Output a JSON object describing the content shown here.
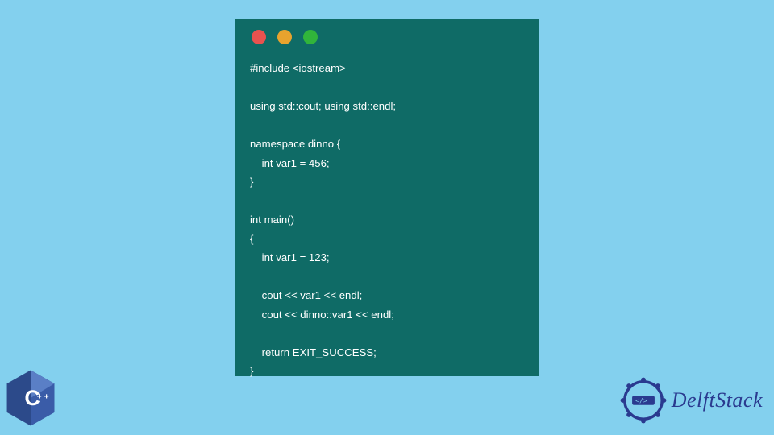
{
  "code_window": {
    "traffic_lights": [
      "red",
      "yellow",
      "green"
    ],
    "code": "#include <iostream>\n\nusing std::cout; using std::endl;\n\nnamespace dinno {\n    int var1 = 456;\n}\n\nint main()\n{\n    int var1 = 123;\n\n    cout << var1 << endl;\n    cout << dinno::var1 << endl;\n\n    return EXIT_SUCCESS;\n}"
  },
  "cpp_badge": {
    "label": "C++"
  },
  "delft": {
    "text": "DelftStack"
  }
}
